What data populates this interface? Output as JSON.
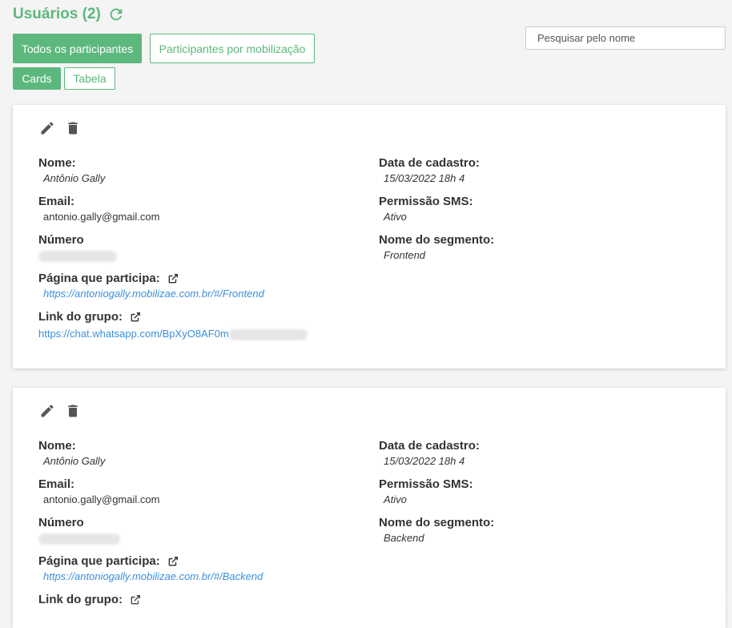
{
  "header": {
    "title": "Usuários (2)",
    "refresh_icon": "refresh-icon"
  },
  "filters": {
    "all_label": "Todos os participantes",
    "by_mobilization_label": "Participantes por mobilização"
  },
  "view": {
    "cards_label": "Cards",
    "table_label": "Tabela"
  },
  "search": {
    "placeholder": "Pesquisar pelo nome"
  },
  "labels": {
    "name": "Nome:",
    "email": "Email:",
    "number": "Número",
    "page": "Página que participa:",
    "group_link": "Link do grupo:",
    "created": "Data de cadastro:",
    "sms": "Permissão SMS:",
    "segment": "Nome do segmento:"
  },
  "cards": [
    {
      "name": "Antônio Gally",
      "email": "antonio.gally@gmail.com",
      "page": "https://antoniogally.mobilizae.com.br/#/Frontend",
      "group_link": "https://chat.whatsapp.com/BpXyO8AF0m",
      "created": "15/03/2022 18h 4",
      "sms": "Ativo",
      "segment": "Frontend"
    },
    {
      "name": "Antônio Gally",
      "email": "antonio.gally@gmail.com",
      "page": "https://antoniogally.mobilizae.com.br/#/Backend",
      "group_link": "",
      "created": "15/03/2022 18h 4",
      "sms": "Ativo",
      "segment": "Backend"
    }
  ],
  "colors": {
    "accent": "#5cb87c",
    "link": "#3b8fdc"
  }
}
